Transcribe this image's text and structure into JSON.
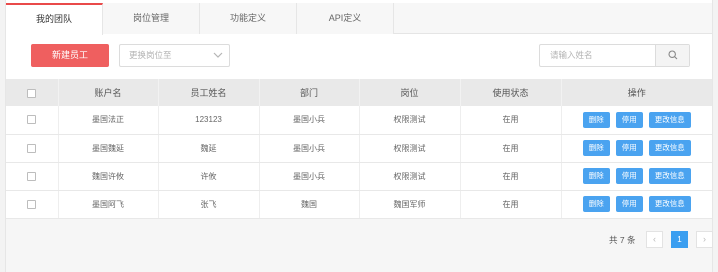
{
  "tabs": [
    "我的团队",
    "岗位管理",
    "功能定义",
    "API定义"
  ],
  "toolbar": {
    "new_button": "新建员工",
    "position_select_placeholder": "更换岗位至",
    "search_placeholder": "请输入姓名"
  },
  "table": {
    "headers": [
      "",
      "账户名",
      "员工姓名",
      "部门",
      "岗位",
      "使用状态",
      "操作"
    ],
    "rows": [
      {
        "account": "墨国法正",
        "name": "123123",
        "dept": "墨国小兵",
        "role": "权限测试",
        "status": "在用"
      },
      {
        "account": "墨国魏延",
        "name": "魏延",
        "dept": "墨国小兵",
        "role": "权限测试",
        "status": "在用"
      },
      {
        "account": "魏国许攸",
        "name": "许攸",
        "dept": "墨国小兵",
        "role": "权限测试",
        "status": "在用"
      },
      {
        "account": "墨国阿飞",
        "name": "张飞",
        "dept": "魏国",
        "role": "魏国军师",
        "status": "在用"
      }
    ],
    "actions": [
      "删除",
      "停用",
      "更改信息"
    ]
  },
  "pagination": {
    "total_label": "共 7 条",
    "current_page": "1",
    "prev": "‹",
    "next": "›"
  },
  "colors": {
    "accent_red": "#ef5f5f",
    "action_blue": "#4aa3f0",
    "page_blue": "#3a9ef0"
  }
}
